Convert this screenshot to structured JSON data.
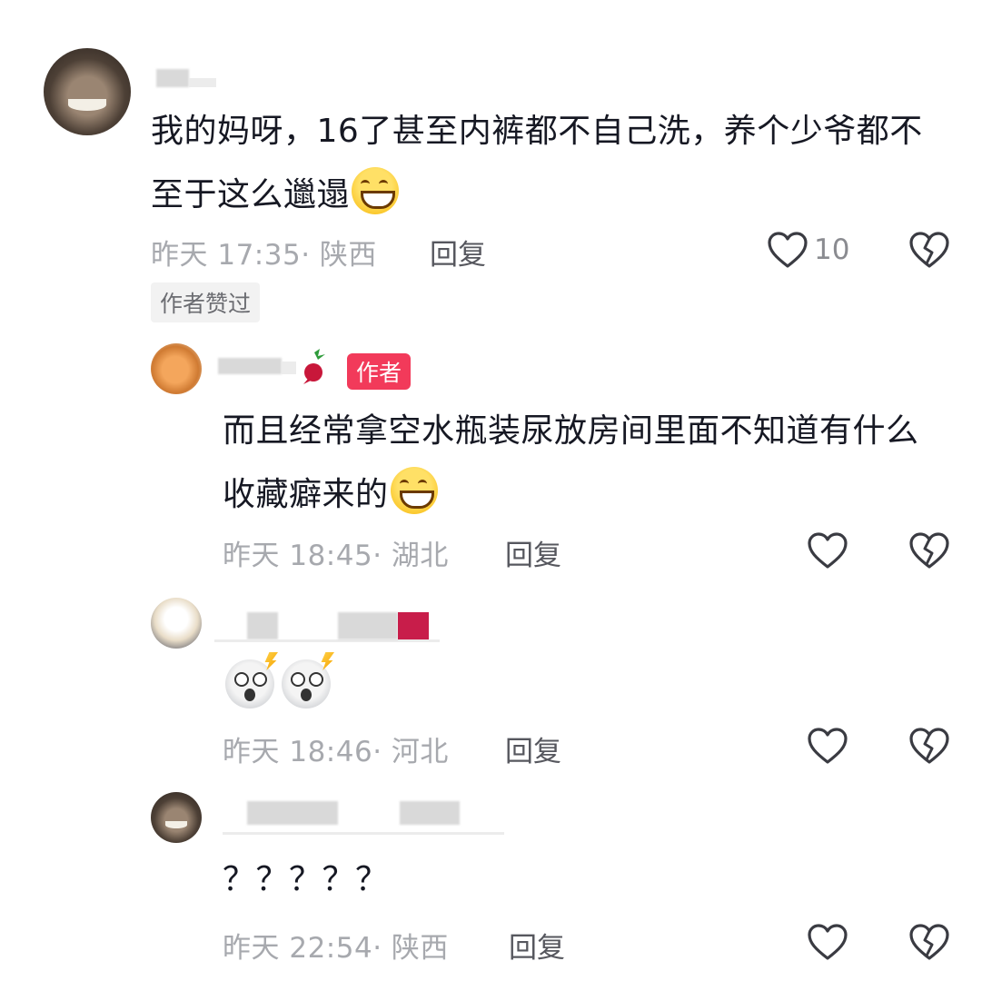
{
  "comments": [
    {
      "text": "我的妈呀，16了甚至内裤都不自己洗，养个少爷都不至于这么邋遢",
      "time_location": "昨天 17:35· 陕西",
      "reply_label": "回复",
      "like_count": "10",
      "liked_by_author_label": "作者赞过"
    },
    {
      "author_badge": "作者",
      "text": "而且经常拿空水瓶装尿放房间里面不知道有什么收藏癖来的",
      "time_location": "昨天 18:45· 湖北",
      "reply_label": "回复"
    },
    {
      "time_location": "昨天 18:46· 河北",
      "reply_label": "回复"
    },
    {
      "text": "？？？？？",
      "time_location": "昨天 22:54· 陕西",
      "reply_label": "回复"
    }
  ],
  "colors": {
    "primary_text": "#161823",
    "meta_text": "#a7a9ae",
    "author_badge": "#f23a5a"
  },
  "icons": [
    "heart-icon",
    "dislike-broken-heart-icon",
    "radish-emoji-icon",
    "grin-emoji-icon",
    "shocked-emoji-icon"
  ]
}
